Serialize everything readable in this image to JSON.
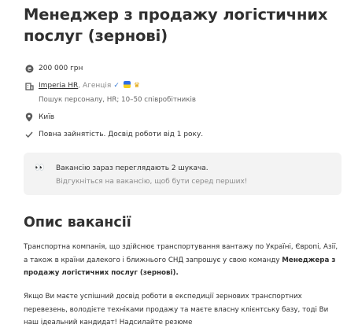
{
  "job": {
    "title": "Менеджер з продажу логістичних послуг (зернові)"
  },
  "details": {
    "salary": "200 000 грн",
    "company_name": "Imperia HR",
    "company_type": ", Агенція",
    "company_description": "Пошук персоналу, HR; 10–50 співробітників",
    "city": "Київ",
    "employment": "Повна зайнятість. Досвід роботи від 1 року."
  },
  "icons": {
    "salary": "coin-icon",
    "company": "building-icon",
    "verified": "checkmark-icon",
    "flag": "ukraine-flag-icon",
    "premium": "crown-icon",
    "city": "location-pin-icon",
    "employment": "check-icon",
    "viewers": "eyes-icon"
  },
  "viewers": {
    "emoji": "👀",
    "title": "Вакансію зараз переглядають 2 шукача.",
    "subtitle": "Відгукніться на вакансію, щоб бути серед перших!"
  },
  "description": {
    "heading": "Опис вакансії",
    "p1_text": "Транспортна компанія, що здійснює транспортування вантажу по Україні, Європі, Азії, а також в країни далекого і ближнього СНД запрошує у свою команду ",
    "p1_bold": "Менеджера з продажу логістичних послуг (зернові).",
    "p2_text": "Якщо Ви маєте успішний досвід роботи в експедиції зернових транспортних перевезень, володієте техніками продажу та маєте власну клієнтську базу, тоді Ви наш ідеальний кандидат! Надсилайте резюме"
  },
  "colors": {
    "text": "#303030",
    "muted": "#8a8a8a",
    "verified": "#3a7bd5",
    "box_bg": "#f3f3f3"
  }
}
